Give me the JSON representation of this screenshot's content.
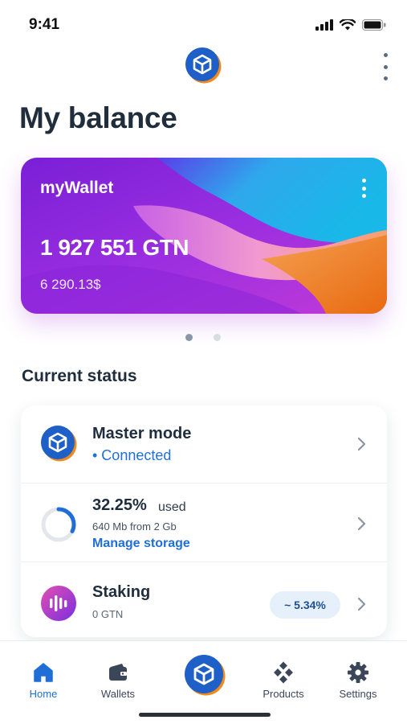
{
  "status_bar": {
    "time": "9:41"
  },
  "header": {
    "title": "My balance"
  },
  "wallet_card": {
    "name": "myWallet",
    "amount": "1 927 551 GTN",
    "usd_value": "6 290.13$"
  },
  "pager": {
    "total": 2,
    "active": 1
  },
  "current_status": {
    "title": "Current status",
    "master_mode": {
      "title": "Master mode",
      "status": "• Connected"
    },
    "storage": {
      "percent": "32.25%",
      "used_label": "used",
      "detail": "640  Mb from 2  Gb",
      "manage_label": "Manage storage",
      "fraction": 0.3225
    },
    "staking": {
      "title": "Staking",
      "amount": "0 GTN",
      "apy": "~ 5.34%"
    }
  },
  "bottom_nav": {
    "home": "Home",
    "wallets": "Wallets",
    "products": "Products",
    "settings": "Settings"
  },
  "colors": {
    "accent": "#1f6fd6",
    "brand_orange": "#f08a1c",
    "title": "#1f2d3d"
  },
  "icons": [
    "signal-icon",
    "wifi-icon",
    "battery-icon",
    "brand-logo-icon",
    "more-vert-icon",
    "chevron-right-icon",
    "storage-ring-icon",
    "staking-bars-icon",
    "home-icon",
    "wallet-icon",
    "products-icon",
    "gear-icon"
  ]
}
